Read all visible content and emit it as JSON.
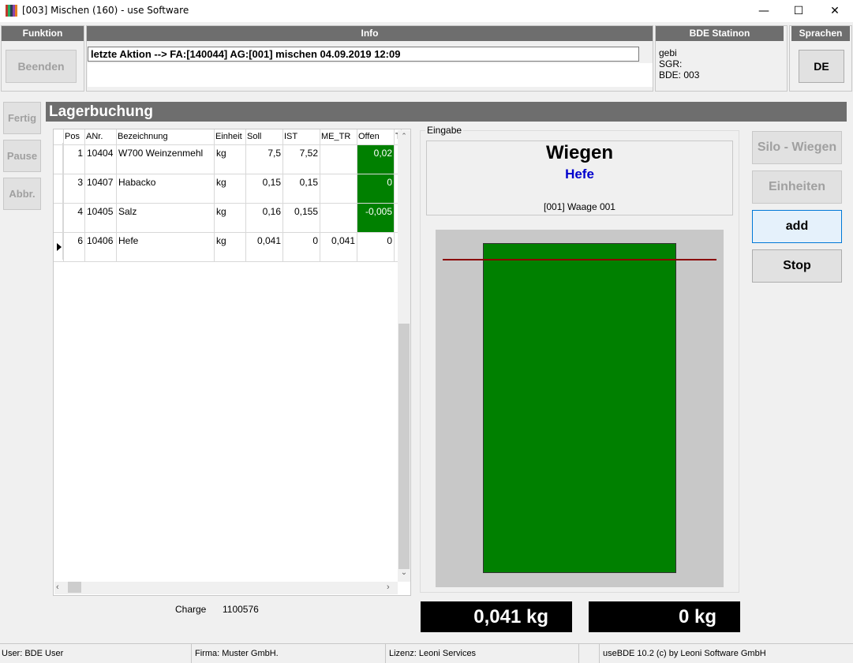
{
  "window": {
    "title": "[003] Mischen (160) - use Software",
    "minimize": "—",
    "maximize": "☐",
    "close": "✕"
  },
  "funktion": {
    "header": "Funktion",
    "beenden": "Beenden"
  },
  "info": {
    "header": "Info",
    "text": "letzte Aktion --> FA:[140044] AG:[001] mischen 04.09.2019 12:09"
  },
  "bde_station": {
    "header": "BDE Statinon",
    "line1": "gebi",
    "line2": "SGR:",
    "line3": "BDE: 003"
  },
  "sprachen": {
    "header": "Sprachen",
    "lang_button": "DE"
  },
  "side_buttons": {
    "fertig": "Fertig",
    "pause": "Pause",
    "abbr": "Abbr."
  },
  "section_title": "Lagerbuchung",
  "table": {
    "columns": [
      "Pos",
      "ANr.",
      "Bezeichnung",
      "Einheit",
      "Soll",
      "IST",
      "ME_TR",
      "Offen",
      "T"
    ],
    "rows": [
      {
        "pos": "1",
        "anr": "10404",
        "bez": "W700 Weinzenmehl",
        "einheit": "kg",
        "soll": "7,5",
        "ist": "7,52",
        "me_tr": "",
        "offen": "0,02",
        "offen_green": true,
        "current": false
      },
      {
        "pos": "3",
        "anr": "10407",
        "bez": "Habacko",
        "einheit": "kg",
        "soll": "0,15",
        "ist": "0,15",
        "me_tr": "",
        "offen": "0",
        "offen_green": true,
        "current": false
      },
      {
        "pos": "4",
        "anr": "10405",
        "bez": "Salz",
        "einheit": "kg",
        "soll": "0,16",
        "ist": "0,155",
        "me_tr": "",
        "offen": "-0,005",
        "offen_green": true,
        "current": false
      },
      {
        "pos": "6",
        "anr": "10406",
        "bez": "Hefe",
        "einheit": "kg",
        "soll": "0,041",
        "ist": "0",
        "me_tr": "0,041",
        "offen": "0",
        "offen_green": false,
        "current": true
      }
    ]
  },
  "charge": {
    "label": "Charge",
    "value": "1100576"
  },
  "eingabe": {
    "label": "Eingabe",
    "mode": "Wiegen",
    "item": "Hefe",
    "scale": "[001] Waage 001"
  },
  "scale_fill": {
    "fraction": 1.0,
    "target_fraction": 0.95
  },
  "weights": {
    "soll": "0,041 kg",
    "ist": "0 kg"
  },
  "right_buttons": {
    "silo": "Silo - Wiegen",
    "einheiten": "Einheiten",
    "add": "add",
    "stop": "Stop"
  },
  "statusbar": {
    "user": "User: BDE User",
    "firma": "Firma: Muster GmbH.",
    "lizenz": "Lizenz: Leoni Services",
    "empty": "",
    "version": "useBDE 10.2 (c) by Leoni Software GmbH"
  },
  "colors": {
    "header_gray": "#6e6e6e",
    "green": "#008000",
    "target_line": "#8b0000",
    "item_blue": "#0000cd"
  }
}
